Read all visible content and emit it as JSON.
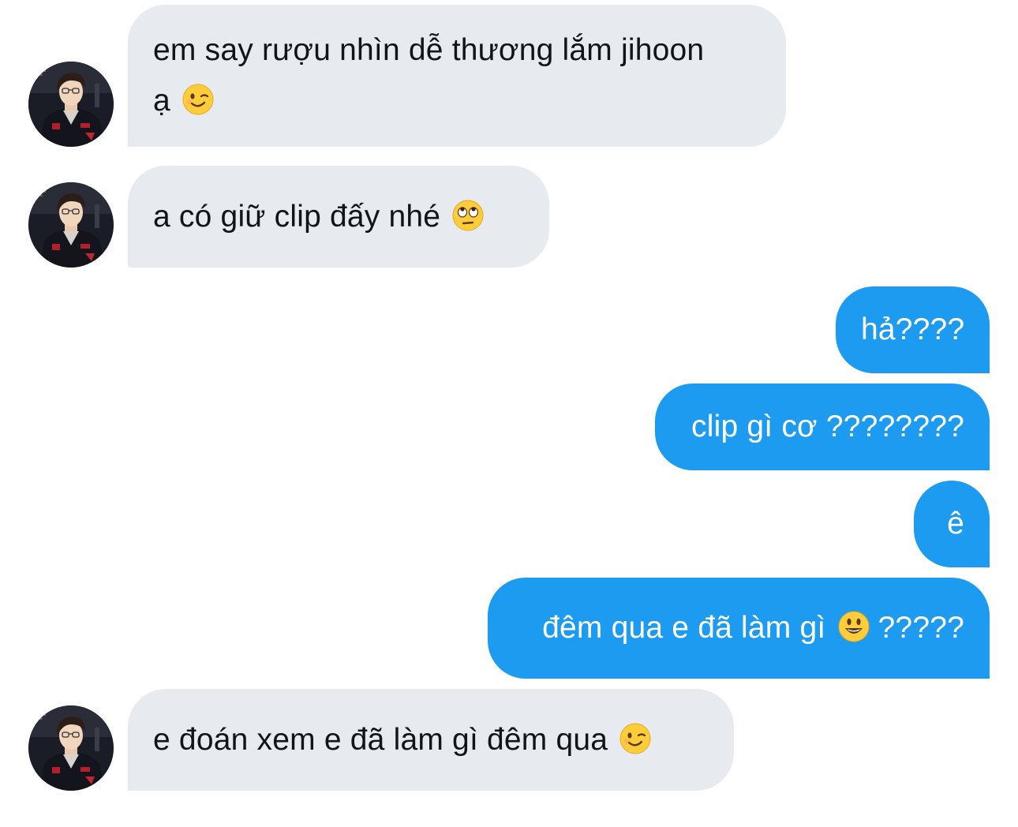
{
  "messages": [
    {
      "id": "m1",
      "side": "in",
      "lines": [
        "em say rượu nhìn dễ thương lắm jihoon",
        "ạ"
      ],
      "emoji": "wink-emoji"
    },
    {
      "id": "m2",
      "side": "in",
      "lines": [
        "a có giữ clip đấy nhé"
      ],
      "emoji": "eye-roll-emoji"
    },
    {
      "id": "m3",
      "side": "out",
      "lines": [
        "hả????"
      ]
    },
    {
      "id": "m4",
      "side": "out",
      "lines": [
        "clip gì cơ ????????"
      ]
    },
    {
      "id": "m5",
      "side": "out",
      "lines": [
        "ê"
      ]
    },
    {
      "id": "m6",
      "side": "out",
      "lines": [
        "đêm qua e đã làm gì",
        "?????"
      ],
      "emoji": "smiley-emoji"
    },
    {
      "id": "m7",
      "side": "in",
      "lines": [
        "e đoán xem e đã làm gì đêm qua"
      ],
      "emoji": "wink-emoji"
    }
  ],
  "colors": {
    "incoming_bubble": "#e7ebef",
    "outgoing_bubble": "#1d9bf0",
    "incoming_text": "#111418",
    "outgoing_text": "#ffffff"
  },
  "icons": {
    "avatar": "profile-photo",
    "wink": "wink-emoji",
    "eye_roll": "eye-roll-emoji",
    "smiley": "smiley-emoji"
  }
}
